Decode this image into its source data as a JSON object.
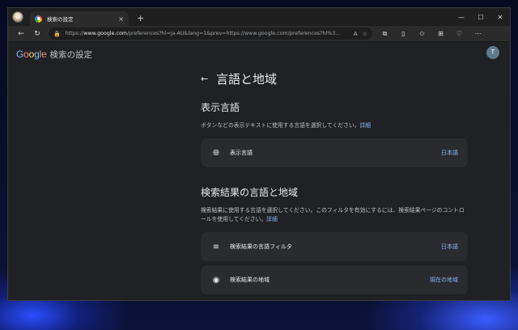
{
  "browser": {
    "tab_title": "検索の設定",
    "tab_close": "×",
    "new_tab": "+",
    "window_controls": [
      "—",
      "☐",
      "✕"
    ],
    "url_prefix": "https://",
    "url_host": "www.google.com",
    "url_rest": "/preferences?hl=ja-AU&lang=1&prev=https://www.google.com/preferences?hl%3..."
  },
  "header": {
    "logo": [
      "G",
      "o",
      "o",
      "g",
      "l",
      "e"
    ],
    "title": "検索の設定",
    "avatar_initial": "T"
  },
  "main": {
    "page_title": "言語と地域",
    "display_language": {
      "heading": "表示言語",
      "description": "ボタンなどの表示テキストに使用する言語を選択してください。",
      "details_link": "詳細",
      "row_label": "表示言語",
      "row_value": "日本語"
    },
    "search_results": {
      "heading": "検索結果の言語と地域",
      "description": "検索結果に使用する言語を選択してください。このフィルタを有効にするには、検索結果ページのコントロールを使用してください。",
      "details_link": "詳細",
      "language_filter_label": "検索結果の言語フィルタ",
      "language_filter_value": "日本語",
      "region_label": "検索結果の地域",
      "region_value": "現在の地域"
    }
  }
}
